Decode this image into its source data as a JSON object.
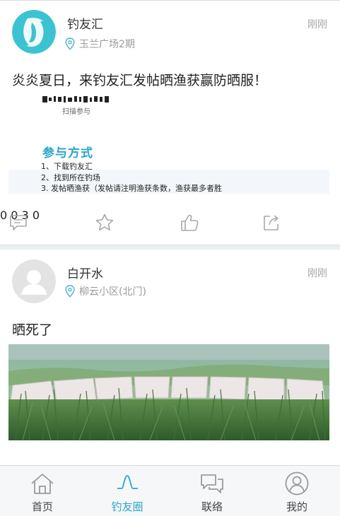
{
  "posts": [
    {
      "user": "钓友汇",
      "time": "刚刚",
      "location": "玉兰广场2期",
      "text": "炎炎夏日，来钓友汇发帖晒渔获赢防晒服！",
      "image": {
        "top_text": "扫描参与",
        "heading": "参与方式",
        "steps": [
          "1、下载钓友汇",
          "2、找到所在钓场",
          "3. 发帖晒渔获（发帖请注明渔获条数，渔获最多者胜"
        ]
      },
      "comments": "0",
      "favorites": "0",
      "likes": "3",
      "shares": "0"
    },
    {
      "user": "白开水",
      "time": "刚刚",
      "location": "柳云小区(北门)",
      "text": "晒死了"
    }
  ],
  "tabbar": {
    "items": [
      {
        "label": "首页",
        "icon": "home-icon"
      },
      {
        "label": "钓友圈",
        "icon": "fishing-circle-icon"
      },
      {
        "label": "联络",
        "icon": "chat-icon"
      },
      {
        "label": "我的",
        "icon": "user-icon"
      }
    ],
    "active_index": 1
  },
  "colors": {
    "accent": "#2aa6c9",
    "logo": "#3cc3d2",
    "icon_gray": "#a9a9a9",
    "separator": "#e9eef0"
  }
}
